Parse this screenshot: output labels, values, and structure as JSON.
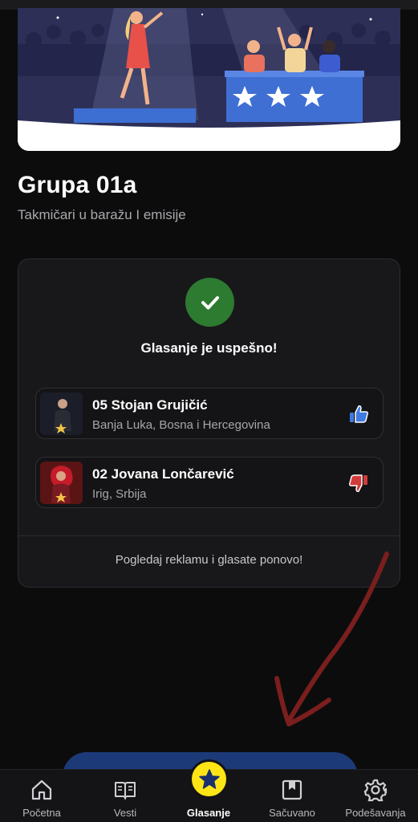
{
  "group": {
    "title": "Grupa 01a",
    "subtitle": "Takmičari u baražu I emisije"
  },
  "result": {
    "status_icon": "check-icon",
    "message": "Glasanje je uspešno!",
    "contestants": [
      {
        "name": "05 Stojan Grujičić",
        "location": "Banja Luka, Bosna i Hercegovina",
        "vote": "thumbs-up-icon",
        "vote_color": "#3f7be0"
      },
      {
        "name": "02 Jovana Lončarević",
        "location": "Irig, Srbija",
        "vote": "thumbs-down-icon",
        "vote_color": "#d33b3b"
      }
    ],
    "rewatch_label": "Pogledaj reklamu i glasate ponovo!"
  },
  "bottom_nav": {
    "items": [
      {
        "label": "Početna",
        "icon": "home-icon"
      },
      {
        "label": "Vesti",
        "icon": "book-icon"
      },
      {
        "label": "Glasanje",
        "icon": "star-icon",
        "active": true
      },
      {
        "label": "Sačuvano",
        "icon": "bookmark-icon"
      },
      {
        "label": "Podešavanja",
        "icon": "gear-icon"
      }
    ]
  },
  "colors": {
    "background": "#0c0c0d",
    "success": "#2d7a31",
    "accent": "#ffe516",
    "cta": "#1c3a78",
    "annotation_arrow": "#7a1e1e"
  }
}
